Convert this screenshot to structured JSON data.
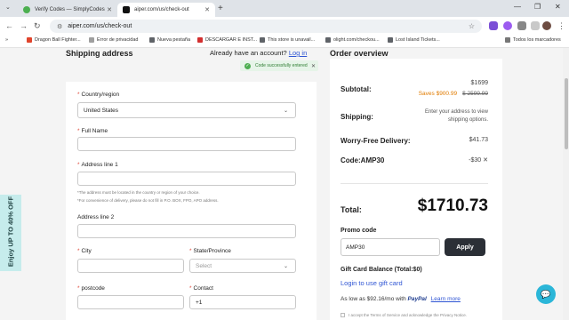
{
  "browser": {
    "tabs": [
      {
        "title": "Verify Codes — SimplyCodes"
      },
      {
        "title": "aiper.com/us/check-out"
      }
    ],
    "new_tab": "+",
    "tab_menu": "⌄",
    "window_controls": {
      "minimize": "—",
      "maximize": "❐",
      "close": "✕"
    },
    "nav": {
      "back": "←",
      "forward": "→",
      "reload": "↻"
    },
    "url": "aiper.com/us/check-out",
    "star": "☆",
    "bookmarks": [
      {
        "label": "Dragon Ball Fighter...",
        "color": "#e0442c"
      },
      {
        "label": "Error de privacidad",
        "color": "#9e9e9e"
      },
      {
        "label": "Nueva pestaña",
        "color": "#5f6368"
      },
      {
        "label": "DESCARGAR E INST...",
        "color": "#d32f2f"
      },
      {
        "label": "This store is unavail...",
        "color": "#5f6368"
      },
      {
        "label": "olight.com/checkou...",
        "color": "#5f6368"
      },
      {
        "label": "Lost Island Tickets...",
        "color": "#5f6368"
      }
    ],
    "all_bookmarks": "Todos los marcadores",
    "more": "»"
  },
  "page": {
    "shipping_title": "Shipping address",
    "account_prompt": "Already have an account?",
    "login_link": "Log in",
    "order_title": "Order overview",
    "toast": {
      "message": "Code successfully entered",
      "close": "✕",
      "check": "✓"
    }
  },
  "form": {
    "country_label": "Country/region",
    "country_value": "United States",
    "fullname_label": "Full Name",
    "address1_label": "Address line 1",
    "hint1": "*The address must be located in the country or region of your choice.",
    "hint2": "*For convenience of delivery, please do not fill in P.O. BOX, FPO, APO address.",
    "address2_label": "Address line 2",
    "city_label": "City",
    "state_label": "State/Province",
    "state_placeholder": "Select",
    "postcode_label": "postcode",
    "contact_label": "Contact",
    "contact_prefix": "+1",
    "required_mark": "*",
    "chevron": "⌄"
  },
  "order": {
    "subtotal_label": "Subtotal:",
    "subtotal_value": "$1699",
    "savings": "Saves $900.99",
    "original_price": "$ 2599.99",
    "shipping_label": "Shipping:",
    "shipping_message": "Enter your address to view shipping options.",
    "worry_label": "Worry-Free Delivery:",
    "worry_value": "$41.73",
    "code_label": "Code:AMP30",
    "code_value": "-$30",
    "code_remove": "✕",
    "total_label": "Total:",
    "total_value": "$1710.73",
    "promo_label": "Promo code",
    "promo_value": "AMP30",
    "apply_label": "Apply",
    "gift_label": "Gift Card Balance (Total:$0)",
    "gift_link": "Login to use gift card",
    "paypal_prefix": "As low as $92.16/mo with",
    "paypal_brand": "PayPal",
    "learn_more": "Learn more",
    "terms": "I accept the Terms of Service and acknowledge the Privacy Notice."
  },
  "promo_tab": {
    "label": "Enjoy UP TO 40% OFF"
  },
  "chat": {
    "icon": "chat-bubble-icon"
  }
}
